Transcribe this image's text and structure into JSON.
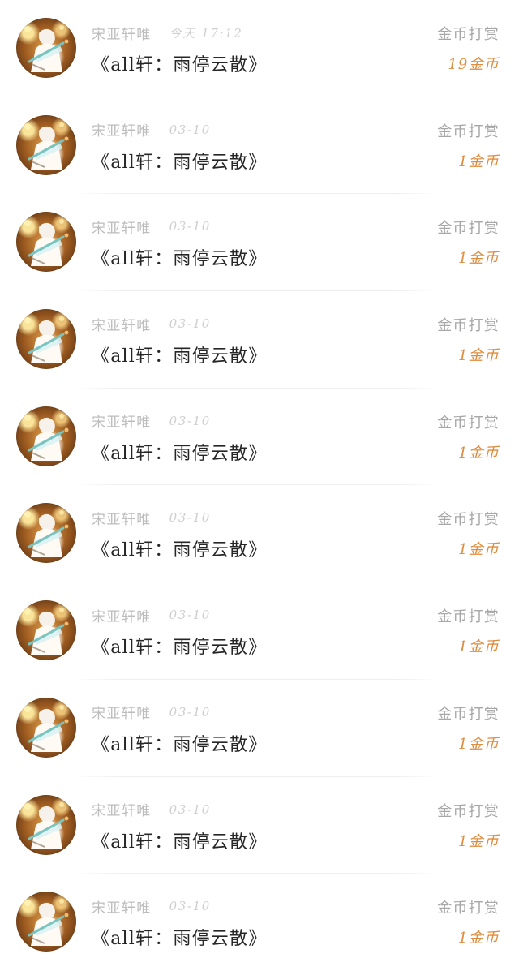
{
  "items": [
    {
      "author": "宋亚轩唯",
      "time": "今天 17:12",
      "title": "《all轩：雨停云散》",
      "action": "金币打赏",
      "amount": "19金币"
    },
    {
      "author": "宋亚轩唯",
      "time": "03-10",
      "title": "《all轩：雨停云散》",
      "action": "金币打赏",
      "amount": "1金币"
    },
    {
      "author": "宋亚轩唯",
      "time": "03-10",
      "title": "《all轩：雨停云散》",
      "action": "金币打赏",
      "amount": "1金币"
    },
    {
      "author": "宋亚轩唯",
      "time": "03-10",
      "title": "《all轩：雨停云散》",
      "action": "金币打赏",
      "amount": "1金币"
    },
    {
      "author": "宋亚轩唯",
      "time": "03-10",
      "title": "《all轩：雨停云散》",
      "action": "金币打赏",
      "amount": "1金币"
    },
    {
      "author": "宋亚轩唯",
      "time": "03-10",
      "title": "《all轩：雨停云散》",
      "action": "金币打赏",
      "amount": "1金币"
    },
    {
      "author": "宋亚轩唯",
      "time": "03-10",
      "title": "《all轩：雨停云散》",
      "action": "金币打赏",
      "amount": "1金币"
    },
    {
      "author": "宋亚轩唯",
      "time": "03-10",
      "title": "《all轩：雨停云散》",
      "action": "金币打赏",
      "amount": "1金币"
    },
    {
      "author": "宋亚轩唯",
      "time": "03-10",
      "title": "《all轩：雨停云散》",
      "action": "金币打赏",
      "amount": "1金币"
    },
    {
      "author": "宋亚轩唯",
      "time": "03-10",
      "title": "《all轩：雨停云散》",
      "action": "金币打赏",
      "amount": "1金币"
    }
  ],
  "colors": {
    "background": "#ffffff",
    "meta": "#bdbdbd",
    "title": "#262626",
    "action": "#a7a7a7",
    "amount": "#e08c3d",
    "divider": "#eeeeee"
  }
}
